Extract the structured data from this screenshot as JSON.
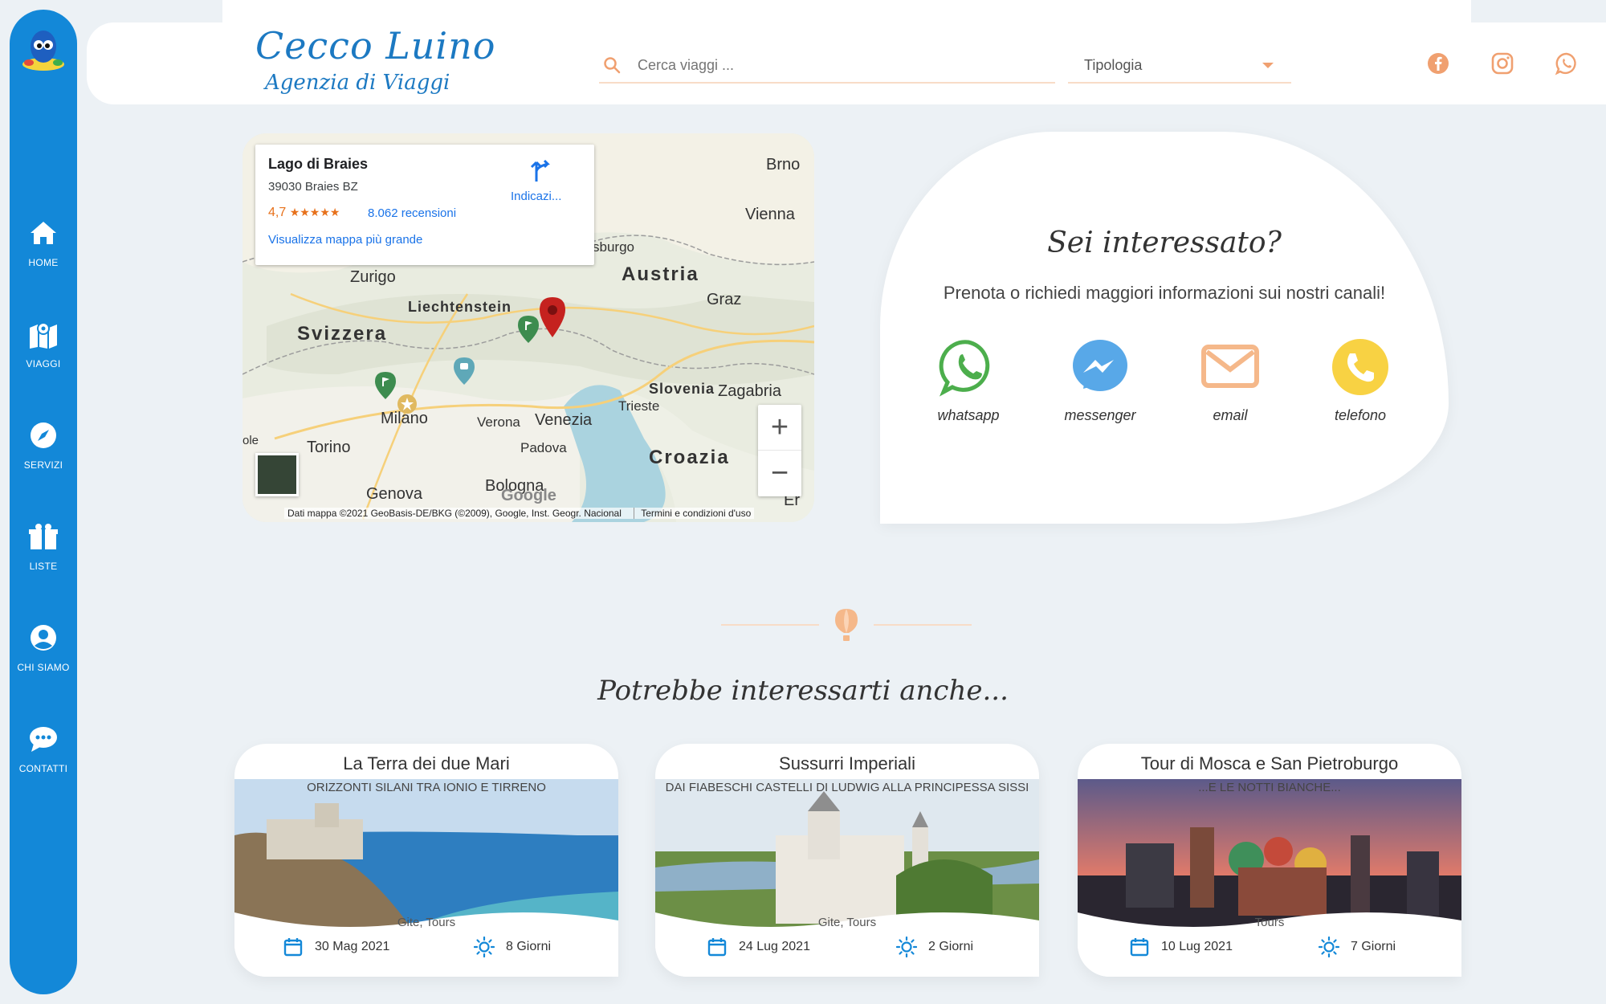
{
  "sidebar": {
    "items": [
      {
        "label": "HOME",
        "icon": "home-icon"
      },
      {
        "label": "VIAGGI",
        "icon": "map-pin-icon"
      },
      {
        "label": "SERVIZI",
        "icon": "compass-icon"
      },
      {
        "label": "LISTE",
        "icon": "gift-icon"
      },
      {
        "label": "CHI SIAMO",
        "icon": "user-icon"
      },
      {
        "label": "CONTATTI",
        "icon": "chat-icon"
      }
    ]
  },
  "header": {
    "logo_line1": "Cecco Luino",
    "logo_line2": "Agenzia di Viaggi",
    "search_placeholder": "Cerca viaggi ...",
    "select_value": "Tipologia",
    "social": [
      "facebook-icon",
      "instagram-icon",
      "whatsapp-icon"
    ],
    "accent_color": "#f0a070"
  },
  "map": {
    "place_name": "Lago di Braies",
    "address": "39030 Braies BZ",
    "rating": "4,7",
    "stars": "★★★★★",
    "reviews": "8.062 recensioni",
    "bigger_map_link": "Visualizza mappa più grande",
    "directions": "Indicazi...",
    "attribution": "Dati mappa ©2021 GeoBasis-DE/BKG (©2009), Google, Inst. Geogr. Nacional",
    "terms": "Termini e condizioni d'uso",
    "zoom_in": "+",
    "zoom_out": "−",
    "google": "Google",
    "labels": {
      "austria": "Austria",
      "svizzera": "Svizzera",
      "croazia": "Croazia",
      "slovenia": "Slovenia",
      "liechtenstein": "Liechtenstein",
      "brno": "Brno",
      "vienna": "Vienna",
      "graz": "Graz",
      "zurigo": "Zurigo",
      "milano": "Milano",
      "torino": "Torino",
      "genova": "Genova",
      "verona": "Verona",
      "venezia": "Venezia",
      "padova": "Padova",
      "trieste": "Trieste",
      "zagabria": "Zagabria",
      "bologna": "Bologna",
      "salisburgo": "sburgo",
      "er": "Er",
      "ole": "ole"
    }
  },
  "contact": {
    "title": "Sei interessato?",
    "subtitle": "Prenota o richiedi maggiori informazioni sui nostri canali!",
    "channels": [
      {
        "label": "whatsapp",
        "color": "#4cae4c"
      },
      {
        "label": "messenger",
        "color": "#58a8e8"
      },
      {
        "label": "email",
        "color": "#f5b88a"
      },
      {
        "label": "telefono",
        "color": "#f8d243"
      }
    ]
  },
  "section_title": "Potrebbe interessarti anche...",
  "cards": [
    {
      "title": "La Terra dei due Mari",
      "subtitle": "ORIZZONTI SILANI TRA IONIO E TIRRENO",
      "category": "Gite, Tours",
      "date": "30 Mag 2021",
      "duration": "8 Giorni"
    },
    {
      "title": "Sussurri Imperiali",
      "subtitle": "DAI FIABESCHI CASTELLI DI LUDWIG ALLA PRINCIPESSA SISSI",
      "category": "Gite, Tours",
      "date": "24 Lug 2021",
      "duration": "2 Giorni"
    },
    {
      "title": "Tour di Mosca e San Pietroburgo",
      "subtitle": "...E LE NOTTI BIANCHE...",
      "category": "Tours",
      "date": "10 Lug 2021",
      "duration": "7 Giorni"
    }
  ]
}
